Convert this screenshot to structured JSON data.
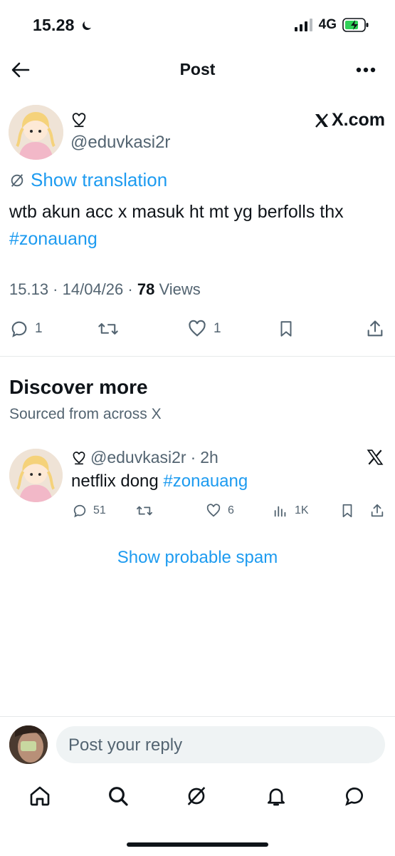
{
  "status_bar": {
    "time": "15.28",
    "network": "4G"
  },
  "header": {
    "title": "Post"
  },
  "post": {
    "handle": "@eduvkasi2r",
    "source_label": "X.com",
    "translate_label": "Show translation",
    "text_plain": "wtb akun acc x masuk ht mt yg berfolls thx ",
    "hashtag": "#zonauang",
    "time": "15.13",
    "date": "14/04/26",
    "views_count": "78",
    "views_label": "Views",
    "actions": {
      "replies": "1",
      "likes": "1"
    }
  },
  "discover": {
    "title": "Discover more",
    "subtitle": "Sourced from across X",
    "item": {
      "handle": "@eduvkasi2r",
      "age": "2h",
      "text_plain": "netflix dong ",
      "hashtag": "#zonauang",
      "replies": "51",
      "likes": "6",
      "views": "1K"
    },
    "spam_link": "Show probable spam"
  },
  "reply": {
    "placeholder": "Post your reply"
  },
  "colors": {
    "accent": "#1d9bf0",
    "text": "#0f1419",
    "muted": "#536471",
    "battery": "#30d158"
  }
}
